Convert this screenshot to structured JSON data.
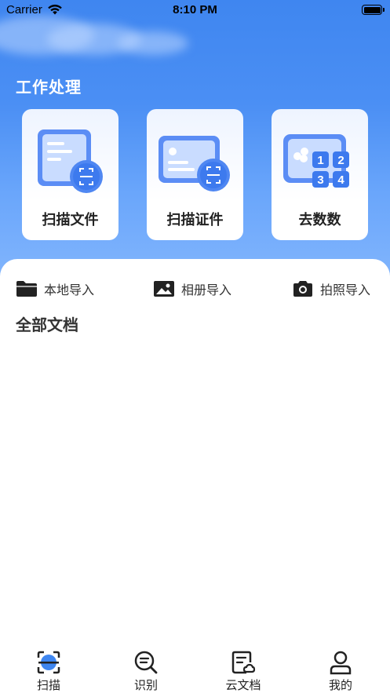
{
  "status_bar": {
    "carrier": "Carrier",
    "time": "8:10 PM"
  },
  "work": {
    "title": "工作处理",
    "cards": [
      {
        "label": "扫描文件",
        "icon": "scan-file-icon"
      },
      {
        "label": "扫描证件",
        "icon": "scan-id-icon"
      },
      {
        "label": "去数数",
        "icon": "count-icon"
      }
    ]
  },
  "imports": [
    {
      "label": "本地导入",
      "icon": "folder-icon"
    },
    {
      "label": "相册导入",
      "icon": "image-icon"
    },
    {
      "label": "拍照导入",
      "icon": "camera-icon"
    }
  ],
  "docs": {
    "title": "全部文档"
  },
  "tabbar": {
    "tabs": [
      {
        "label": "扫描",
        "icon": "scan-icon",
        "active": true
      },
      {
        "label": "识别",
        "icon": "recognize-icon",
        "active": false
      },
      {
        "label": "云文档",
        "icon": "cloud-doc-icon",
        "active": false
      },
      {
        "label": "我的",
        "icon": "profile-icon",
        "active": false
      }
    ]
  },
  "colors": {
    "accent": "#3f86f0",
    "card_icon": "#5b8df5",
    "text_dark": "#222222"
  }
}
